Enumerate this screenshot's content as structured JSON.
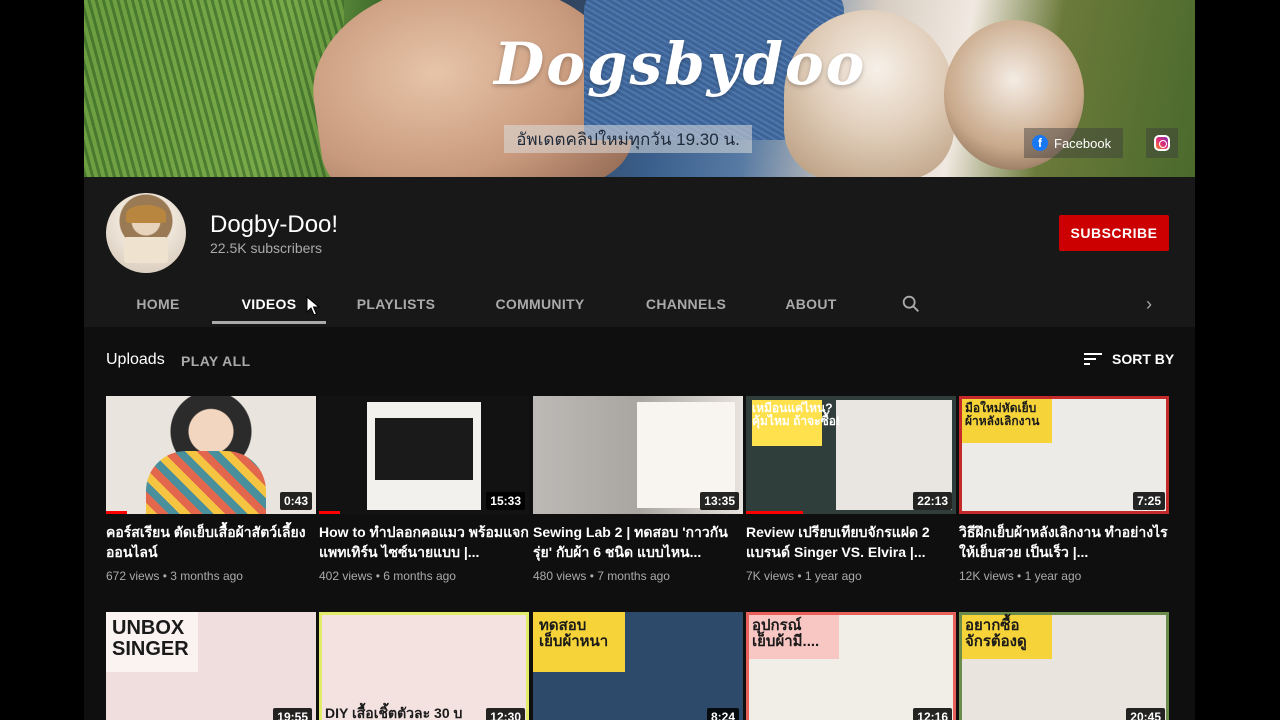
{
  "banner": {
    "brand": "Dogsbydoo",
    "tagline": "อัพเดตคลิปใหม่ทุกวัน 19.30 น.",
    "facebook_label": "Facebook",
    "facebook_glyph": "f"
  },
  "channel": {
    "name": "Dogby-Doo!",
    "subscribers": "22.5K subscribers",
    "subscribe_label": "SUBSCRIBE",
    "subscribe_color": "#cc0000"
  },
  "tabs": [
    {
      "label": "HOME",
      "active": false
    },
    {
      "label": "VIDEOS",
      "active": true
    },
    {
      "label": "PLAYLISTS",
      "active": false
    },
    {
      "label": "COMMUNITY",
      "active": false
    },
    {
      "label": "CHANNELS",
      "active": false
    },
    {
      "label": "ABOUT",
      "active": false
    }
  ],
  "tab_next_glyph": "›",
  "uploads": {
    "title": "Uploads",
    "play_all": "PLAY ALL",
    "sort_by": "SORT BY"
  },
  "videos": [
    {
      "title": "คอร์สเรียน ตัดเย็บเสื้อผ้าสัตว์เลี้ยง ออนไลน์",
      "views": "672 views",
      "age": "3 months ago",
      "duration": "0:43",
      "watched": 0.1
    },
    {
      "title": "How to ทำปลอกคอแมว พร้อมแจกแพทเทิร์น ไซซ์นายแบบ |...",
      "views": "402 views",
      "age": "6 months ago",
      "duration": "15:33",
      "watched": 0.1
    },
    {
      "title": "Sewing Lab 2 | ทดสอบ 'กาวกันรุ่ย' กับผ้า 6 ชนิด แบบไหน...",
      "views": "480 views",
      "age": "7 months ago",
      "duration": "13:35",
      "watched": 0
    },
    {
      "title": "Review เปรียบเทียบจักรแฝด 2 แบรนด์ Singer VS. Elvira |...",
      "views": "7K views",
      "age": "1 year ago",
      "duration": "22:13",
      "watched": 0.27
    },
    {
      "title": "วิธีฝึกเย็บผ้าหลังเลิกงาน ทำอย่างไรให้เย็บสวย เป็นเร็ว |...",
      "views": "12K views",
      "age": "1 year ago",
      "duration": "7:25",
      "watched": 0
    }
  ],
  "videos_row2": [
    {
      "duration": "19:55",
      "overlay": "UNBOX\nSINGER"
    },
    {
      "duration": "12:30",
      "overlay": "DIY เสื้อเชิ้ตตัวละ 30 บ"
    },
    {
      "duration": "8:24",
      "overlay": "ทดสอบ\nเย็บผ้าหนา"
    },
    {
      "duration": "12:16",
      "overlay": "อุปกรณ์\nเย็บผ้ามี...."
    },
    {
      "duration": "20:45",
      "overlay": "อยากซื้อ\nจักรต้องดู"
    }
  ],
  "thumb_overlays": {
    "t4": "เหมือนแค่ไหน?\nคุ้มไหม ถ้าจะซื้อ!",
    "t5": "มือใหม่หัดเย็บ\nผ้าหลังเลิกงาน"
  }
}
